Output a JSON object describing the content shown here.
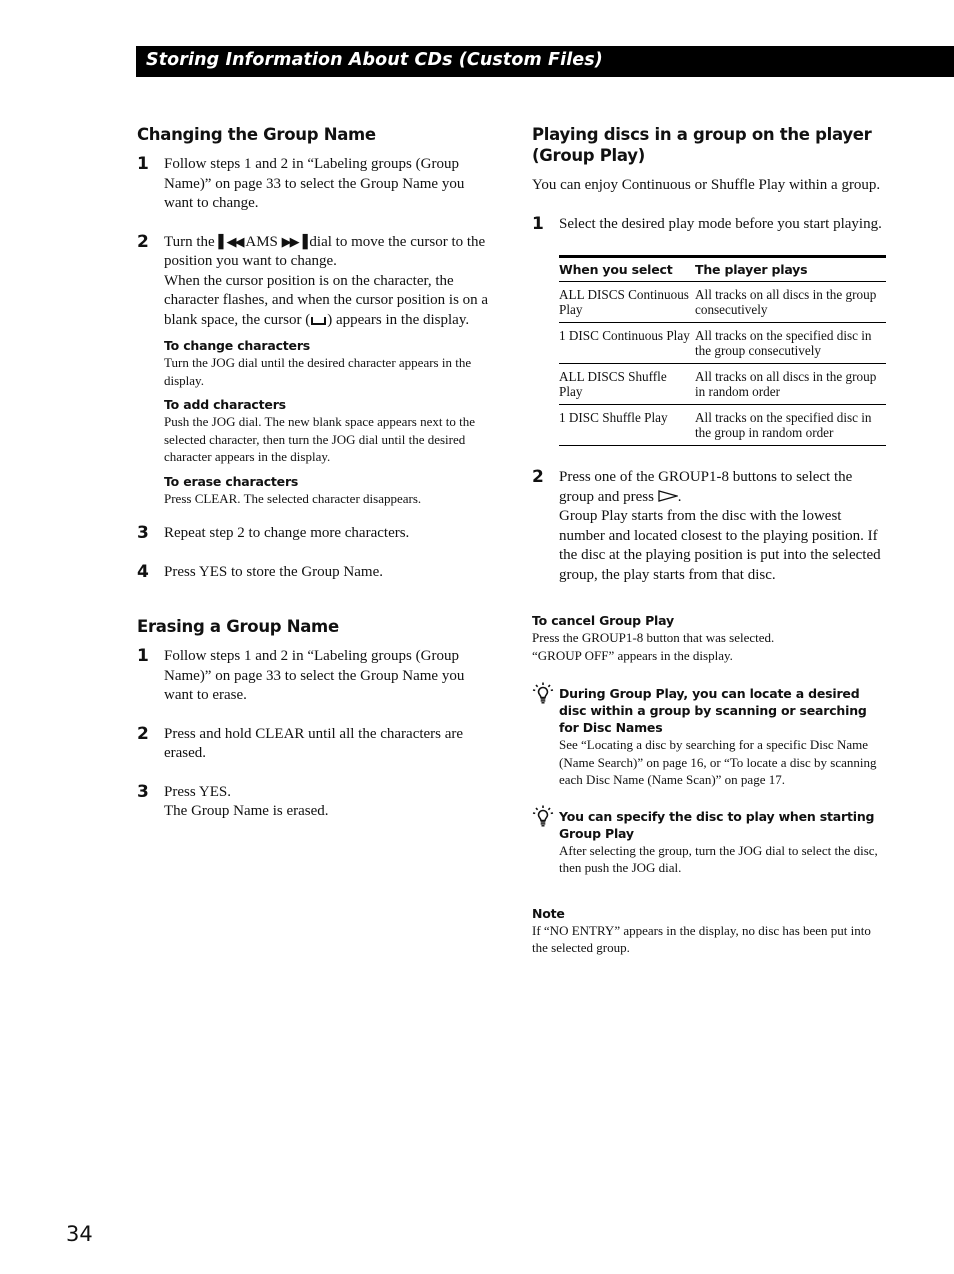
{
  "banner": {
    "title": "Storing Information About CDs (Custom Files)"
  },
  "left": {
    "changing": {
      "heading": "Changing the Group Name",
      "step1": {
        "num": "1",
        "text": "Follow steps 1 and 2 in “Labeling groups (Group Name)” on page 33 to select the Group Name you want to change."
      },
      "step2": {
        "num": "2",
        "text_a": "Turn the",
        "prev_icon": "⏮",
        "text_b": " AMS ",
        "next_icon": "⏭",
        "text_c": " dial to move the cursor to the position you want to change.",
        "text_d": "When the cursor position is on the character, the character flashes, and when the cursor position is on a blank space, the cursor (",
        "text_e": ") appears in the display."
      },
      "sub": [
        {
          "heading": "To change characters",
          "text": "Turn the JOG dial until the desired character appears in the display."
        },
        {
          "heading": "To add characters",
          "text": "Push the JOG dial. The new blank space appears next to the selected character, then turn the JOG dial until the desired character appears in the display."
        },
        {
          "heading": "To erase characters",
          "text": "Press CLEAR. The selected character disappears."
        }
      ],
      "step3": {
        "num": "3",
        "text": "Repeat step 2 to change more characters."
      },
      "step4": {
        "num": "4",
        "text": "Press YES to store the Group Name."
      }
    },
    "erasing": {
      "heading": "Erasing a Group Name",
      "step1": {
        "num": "1",
        "text": "Follow steps 1 and 2 in “Labeling groups (Group Name)” on page 33 to select the Group Name you want to erase."
      },
      "step2": {
        "num": "2",
        "text": "Press and hold CLEAR until all the characters are erased."
      },
      "step3": {
        "num": "3",
        "text_a": "Press YES.",
        "text_b": "The Group Name is erased."
      }
    }
  },
  "right": {
    "heading": "Playing discs in a group on the player (Group Play)",
    "intro": "You can enjoy Continuous or Shuffle Play within a group.",
    "step1": {
      "num": "1",
      "text": "Select the desired play mode before you start playing."
    },
    "table": {
      "headers": [
        "When you select",
        "The player plays"
      ],
      "rows": [
        [
          "ALL DISCS Continuous Play",
          "All tracks on all discs in the group consecutively"
        ],
        [
          "1 DISC Continuous Play",
          "All tracks on the specified disc in the group consecutively"
        ],
        [
          "ALL DISCS Shuffle Play",
          "All tracks on all discs in the group in random order"
        ],
        [
          "1 DISC Shuffle Play",
          "All tracks on the specified disc in the group in random order"
        ]
      ]
    },
    "step2": {
      "num": "2",
      "text_a": "Press one of the GROUP1-8 buttons to select the group and press ",
      "text_b": ".",
      "text_c": "Group Play starts from the disc with the lowest number and located closest to the playing position. If the disc at the playing position is put into the selected group, the play starts from that disc."
    },
    "cancel": {
      "heading": "To cancel Group Play",
      "line1": "Press the GROUP1-8 button that was selected.",
      "line2": "“GROUP OFF” appears in the display."
    },
    "tips": [
      {
        "heading": "During Group Play, you can locate a desired disc within a group by scanning or searching for Disc Names",
        "text": "See “Locating a disc by searching for a specific Disc Name (Name Search)” on page 16, or “To locate a disc by scanning each Disc Name (Name Scan)” on page 17."
      },
      {
        "heading": "You can specify the disc to play when starting Group Play",
        "text": "After selecting the group, turn the JOG dial to select the disc, then push the JOG dial."
      }
    ],
    "note": {
      "heading": "Note",
      "text": "If “NO ENTRY” appears in the display, no disc has been put into the selected group."
    }
  },
  "page_number": "34"
}
